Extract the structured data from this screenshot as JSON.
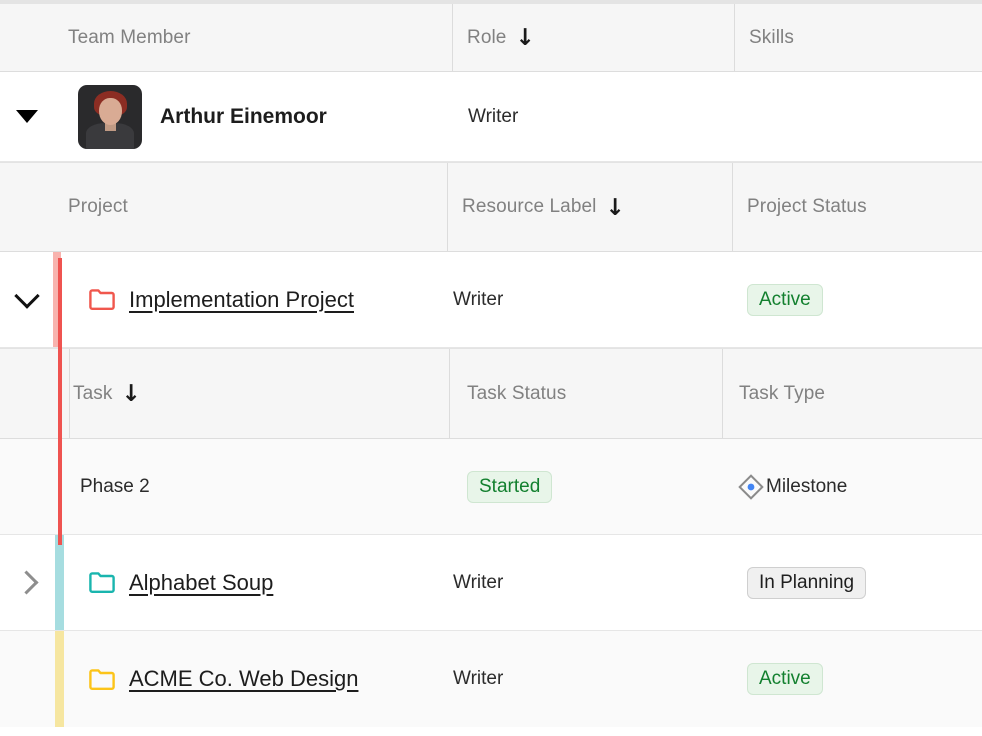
{
  "headers": {
    "member_level": {
      "col1": "Team Member",
      "col2": "Role",
      "col2_sort": "↓",
      "col3": "Skills"
    },
    "project_level": {
      "col1": "Project",
      "col2": "Resource Label",
      "col2_sort": "↓",
      "col3": "Project Status"
    },
    "task_level": {
      "col1": "Task",
      "col1_sort": "↓",
      "col2": "Task Status",
      "col3": "Task Type"
    }
  },
  "member": {
    "name": "Arthur Einemoor",
    "role": "Writer",
    "skills": "",
    "expanded": true,
    "toggle_icon": "triangle-down-icon",
    "avatar_icon": "user-avatar-photo"
  },
  "projects": [
    {
      "name": "Implementation Project",
      "resource_label": "Writer",
      "status": "Active",
      "status_style": "green",
      "expanded": true,
      "toggle_icon": "chevron-down-icon",
      "folder_icon": "folder-icon",
      "folder_color": "#f0574d",
      "accent_color": "#ef5350",
      "accent_light": "#f8b3ae",
      "tasks": [
        {
          "name": "Phase 2",
          "status": "Started",
          "status_style": "green",
          "type": "Milestone",
          "type_icon": "milestone-diamond-icon"
        }
      ]
    },
    {
      "name": "Alphabet Soup",
      "resource_label": "Writer",
      "status": "In Planning",
      "status_style": "gray",
      "expanded": false,
      "toggle_icon": "chevron-right-icon",
      "folder_icon": "folder-icon",
      "folder_color": "#19b5ae",
      "accent_color": "#a6dde0",
      "accent_light": "#a6dde0",
      "tasks": []
    },
    {
      "name": "ACME Co. Web Design",
      "resource_label": "Writer",
      "status": "Active",
      "status_style": "green",
      "expanded": false,
      "toggle_icon": "",
      "folder_icon": "folder-icon",
      "folder_color": "#fcc419",
      "accent_color": "#f6e6a0",
      "accent_light": "#f6e6a0",
      "tasks": []
    }
  ],
  "colors": {
    "header_bg": "#f6f6f6",
    "header_text": "#818181",
    "row_bg": "#ffffff",
    "row_shaded_bg": "#fafafa",
    "badge_green_bg": "#e8f5e9",
    "badge_green_text": "#13802f",
    "badge_gray_bg": "#f0f0f0",
    "badge_gray_text": "#1f1f1f",
    "milestone_dot": "#4285f4",
    "milestone_outline": "#8a8a8a"
  }
}
